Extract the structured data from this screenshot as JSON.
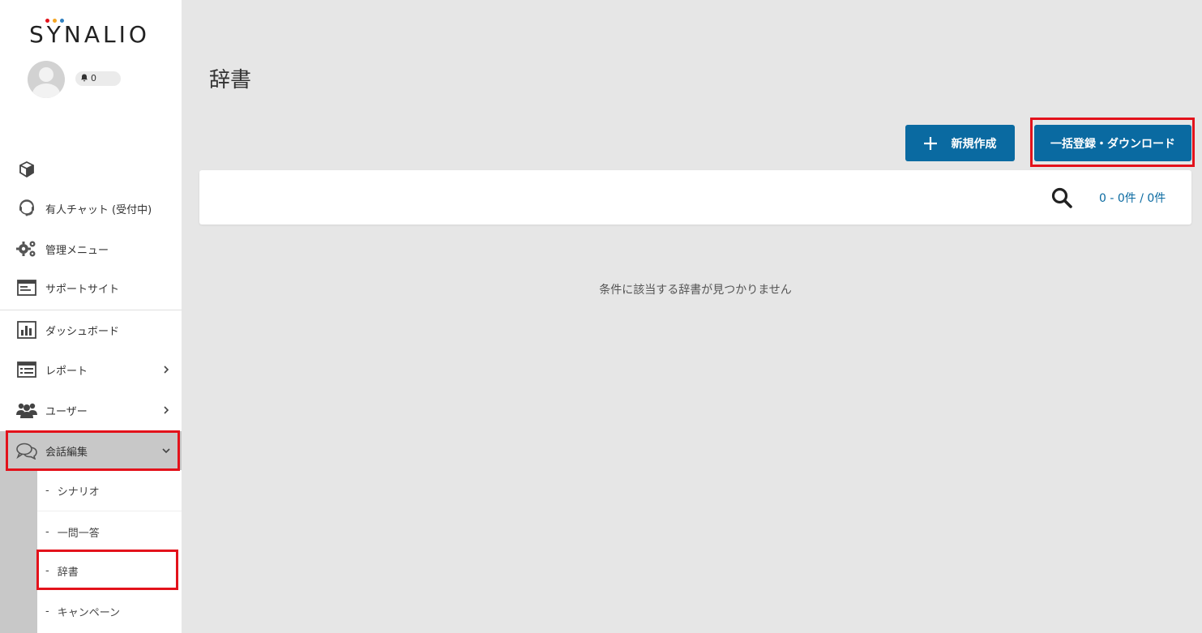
{
  "brand": {
    "logo_text_pre": "S",
    "logo_text_y": "Y",
    "logo_text_post": "NALIO",
    "dot_colors": [
      "#e3121b",
      "#f5a623",
      "#2f80c0"
    ]
  },
  "user": {
    "notification_count": "0"
  },
  "sidebar": {
    "items": [
      {
        "label": "",
        "icon": "cube-icon"
      },
      {
        "label": "有人チャット (受付中)",
        "icon": "operator-headset-icon"
      },
      {
        "label": "管理メニュー",
        "icon": "gears-icon"
      },
      {
        "label": "サポートサイト",
        "icon": "browser-window-icon"
      },
      {
        "label": "ダッシュボード",
        "icon": "bar-chart-icon"
      },
      {
        "label": "レポート",
        "icon": "list-icon"
      },
      {
        "label": "ユーザー",
        "icon": "users-icon"
      },
      {
        "label": "会話編集",
        "icon": "chat-bubbles-icon"
      }
    ],
    "sub_items": [
      {
        "label": "シナリオ"
      },
      {
        "label": "一問一答"
      },
      {
        "label": "辞書"
      },
      {
        "label": "キャンペーン"
      }
    ],
    "sub_dash": "-"
  },
  "main": {
    "title": "辞書",
    "new_button_label": "新規作成",
    "bulk_button_label": "一括登録・ダウンロード",
    "result_count": "0 - 0件 / 0件",
    "empty_message": "条件に該当する辞書が見つかりません"
  },
  "colors": {
    "primary": "#0a6aa1",
    "highlight": "#e3121b",
    "background": "#e6e6e6"
  }
}
